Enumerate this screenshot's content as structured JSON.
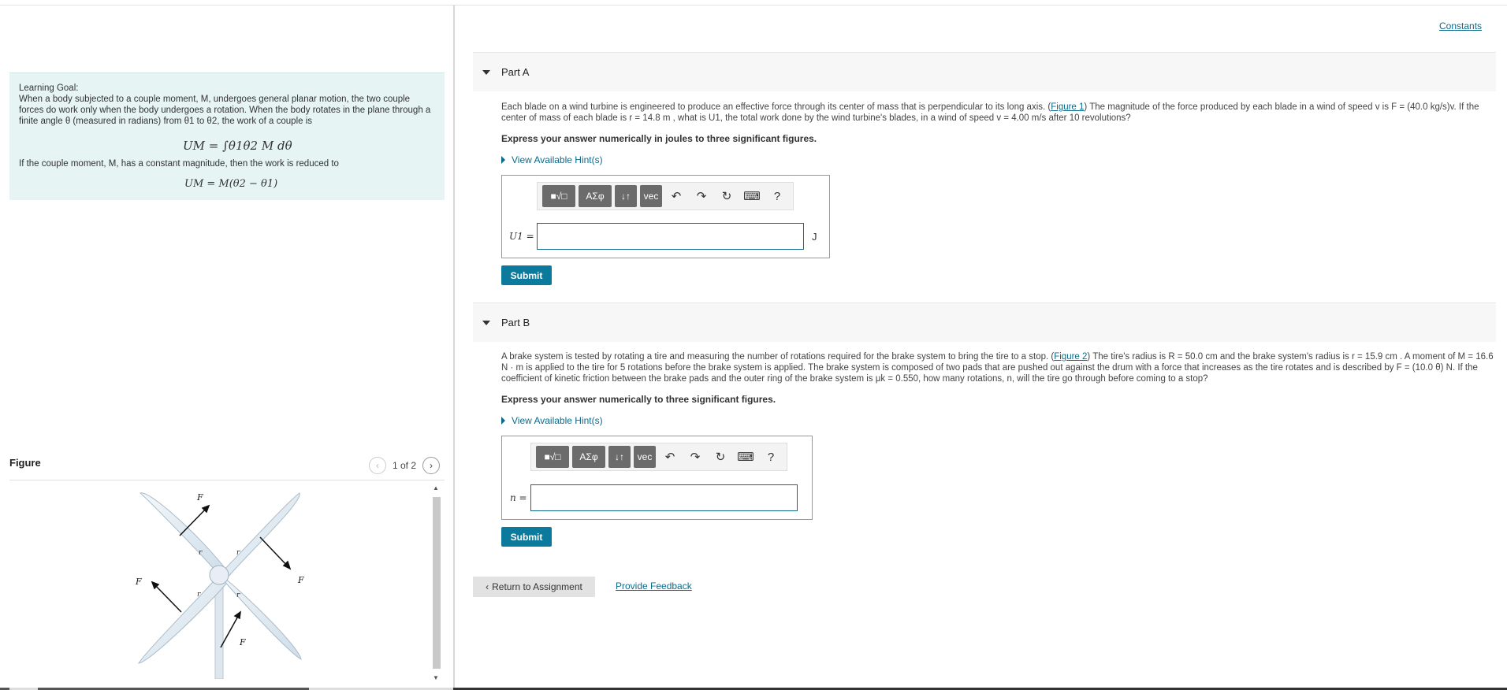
{
  "header": {
    "constants_link": "Constants"
  },
  "learning_goal": {
    "title": "Learning Goal:",
    "text1": "When a body subjected to a couple moment, M, undergoes general planar motion, the two couple forces do work only when the body undergoes a rotation.  When the body rotates in the plane through a finite angle θ (measured in radians) from θ1 to θ2, the work of a couple is",
    "equation1": "UM = ∫θ1θ2 M dθ",
    "text2": "If the couple moment, M, has a constant magnitude, then the work is reduced to",
    "equation2": "UM = M(θ2 − θ1)"
  },
  "figure": {
    "label": "Figure",
    "counter": "1 of 2",
    "force_labels": [
      "F",
      "F",
      "F",
      "F"
    ],
    "radius_labels": [
      "r",
      "r",
      "r",
      "r"
    ]
  },
  "partA": {
    "title": "Part A",
    "question_pre": "Each blade on a wind turbine is engineered to produce an effective force through its center of mass that is perpendicular to its long axis. (",
    "figure_link": "Figure 1",
    "question_post": ") The magnitude of the force produced by each blade in a wind of speed v is F = (40.0 kg/s)v. If the center of mass of each blade is r = 14.8 m , what is U1, the total work done by the wind turbine's blades, in a wind of speed v = 4.00 m/s after 10 revolutions?",
    "express": "Express your answer numerically in joules to three significant figures.",
    "hint": "View Available Hint(s)",
    "answer_label": "U1 =",
    "unit": "J",
    "answer_value": "",
    "submit": "Submit"
  },
  "partB": {
    "title": "Part B",
    "question_pre": "A brake system is tested by rotating a tire and measuring the number of rotations required for the brake system to bring the tire to a stop. (",
    "figure_link": "Figure 2",
    "question_post": ") The tire's radius is R = 50.0 cm and the brake system's radius is r = 15.9 cm . A moment of M = 16.6 N · m is applied to the tire for 5 rotations before the brake system is applied.  The brake system is composed of two pads that are pushed out against the drum with a force that increases as the tire rotates and is described by F = (10.0 θ) N.  If the coefficient of kinetic friction between the brake pads and the outer ring of the brake system is μk = 0.550, how many rotations, n, will the tire go through before coming to a stop?",
    "express": "Express your answer numerically to three significant figures.",
    "hint": "View Available Hint(s)",
    "answer_label": "n =",
    "answer_value": "",
    "submit": "Submit"
  },
  "toolbar": {
    "templates": "■√□",
    "greek": "ΑΣφ",
    "arrows": "↓↑",
    "vec": "vec",
    "undo_icon": "undo-icon",
    "redo_icon": "redo-icon",
    "reset_icon": "reset-icon",
    "keyboard_icon": "keyboard-icon",
    "help": "?"
  },
  "footer": {
    "return": "Return to Assignment",
    "feedback": "Provide Feedback"
  }
}
